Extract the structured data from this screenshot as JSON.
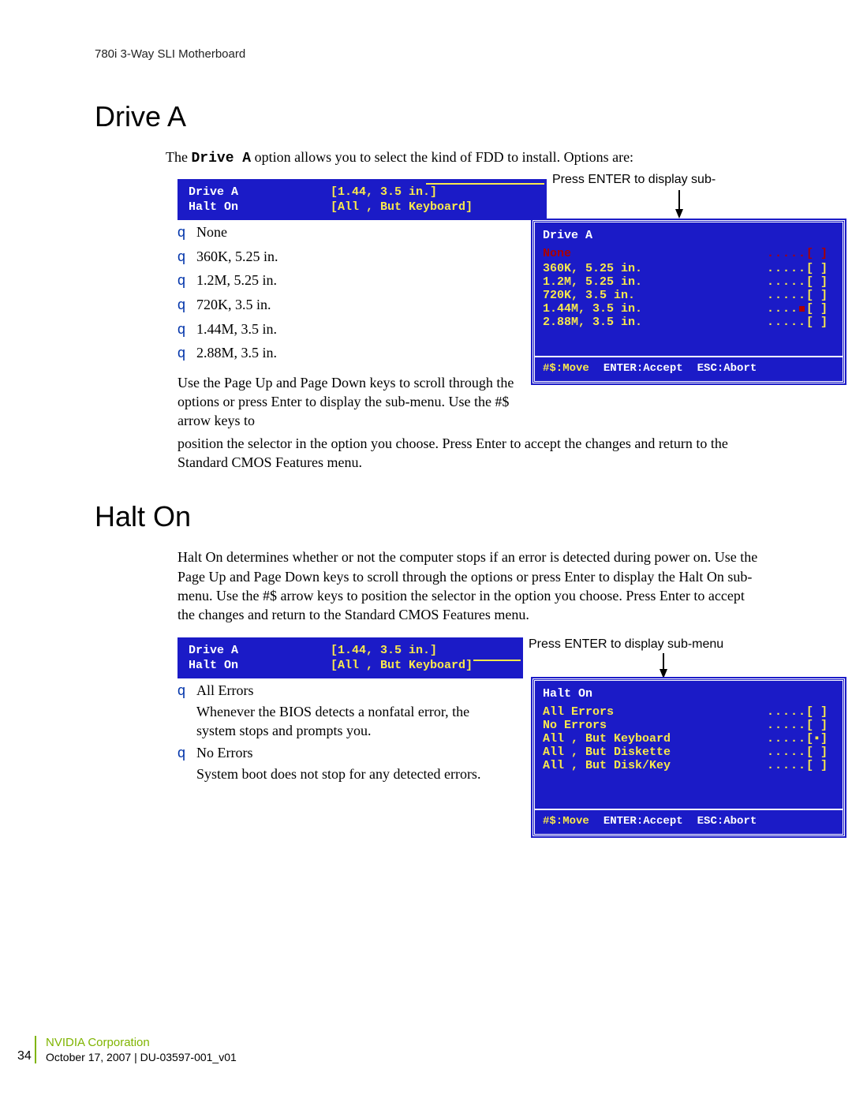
{
  "header": "780i 3-Way SLI Motherboard",
  "driveA": {
    "title": "Drive A",
    "intro_pre": "The ",
    "intro_mono": "Drive A",
    "intro_post": " option allows you to select the kind of FDD to install. Options are:",
    "bios": {
      "l1_label": "Drive A",
      "l1_val": "[1.44, 3.5 in.]",
      "l2_label": "Halt On",
      "l2_val": "[All , But Keyboard]"
    },
    "annot": "Press ENTER to display sub-",
    "bullets": [
      "None",
      "360K, 5.25 in.",
      "1.2M, 5.25 in.",
      "720K, 3.5 in.",
      "1.44M, 3.5 in.",
      "2.88M, 3.5 in."
    ],
    "sub": {
      "title": "Drive A",
      "opts": [
        {
          "name": "None",
          "mark": "[ ]",
          "none": true
        },
        {
          "name": "360K, 5.25 in.",
          "mark": "[ ]"
        },
        {
          "name": "1.2M, 5.25 in.",
          "mark": "[ ]"
        },
        {
          "name": "720K, 3.5 in.",
          "mark": "[ ]"
        },
        {
          "name": "1.44M, 3.5 in.",
          "mark": "[ ]",
          "selected": true
        },
        {
          "name": "2.88M, 3.5 in.",
          "mark": "[ ]"
        }
      ],
      "kmove": "#$:Move",
      "kaccept": "ENTER:Accept",
      "kabort": "ESC:Abort"
    },
    "wrap": "Use the Page Up and Page Down keys to scroll through the options or press Enter to display the sub-menu. Use the #$ arrow keys to",
    "after": "position the selector in the option you choose. Press Enter to accept the changes and return to the Standard CMOS Features menu."
  },
  "haltOn": {
    "title": "Halt On",
    "para": "Halt On determines whether or not the computer stops if an error is detected during power on. Use the Page Up and Page Down keys to scroll through the options or press Enter to display the Halt On sub-menu. Use the #$ arrow keys to position the selector in the option you choose. Press Enter to accept the changes and return to the Standard CMOS Features menu.",
    "bios": {
      "l1_label": "Drive A",
      "l1_val": "[1.44, 3.5 in.]",
      "l2_label": "Halt On",
      "l2_val": "[All , But Keyboard]"
    },
    "annot": "Press ENTER to display sub-menu",
    "bullets": [
      {
        "title": "All Errors",
        "desc": "Whenever the BIOS detects a nonfatal error, the system stops and prompts you."
      },
      {
        "title": "No Errors",
        "desc": "System boot does not stop for any detected errors."
      }
    ],
    "sub": {
      "title": "Halt On",
      "opts": [
        {
          "name": "All Errors",
          "mark": "[ ]"
        },
        {
          "name": "No Errors",
          "mark": "[ ]"
        },
        {
          "name": "All , But Keyboard",
          "mark": "[▪]",
          "selected": true
        },
        {
          "name": "All , But Diskette",
          "mark": "[ ]"
        },
        {
          "name": "All , But Disk/Key",
          "mark": "[ ]"
        }
      ],
      "kmove": "#$:Move",
      "kaccept": "ENTER:Accept",
      "kabort": "ESC:Abort"
    }
  },
  "footer": {
    "corp": "NVIDIA Corporation",
    "date": "October 17, 2007  |  DU-03597-001_v01",
    "page": "34"
  }
}
